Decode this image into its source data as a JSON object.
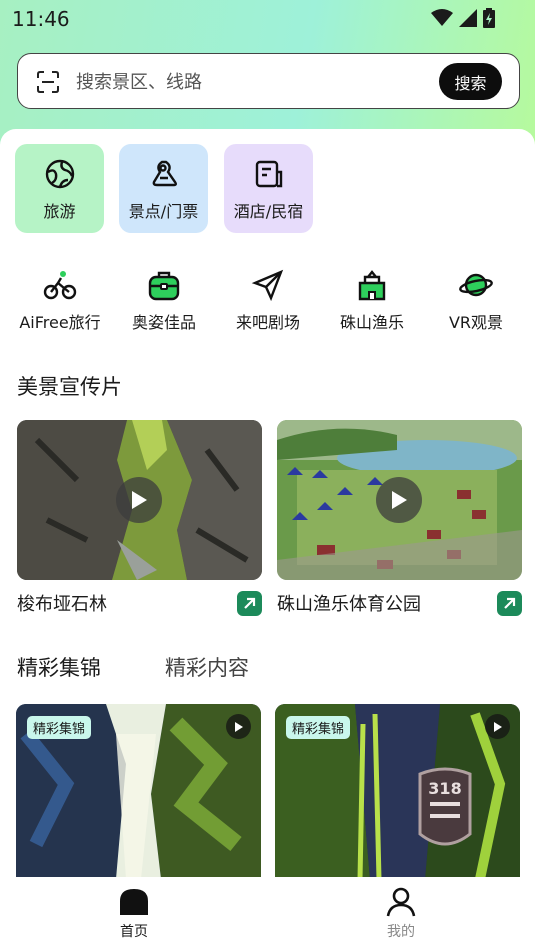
{
  "status_bar": {
    "time": "11:46"
  },
  "search": {
    "placeholder": "搜索景区、线路",
    "button": "搜索"
  },
  "categories": [
    {
      "label": "旅游",
      "icon": "globe-icon",
      "bg": "#b6f3c6"
    },
    {
      "label": "景点/门票",
      "icon": "ticket-icon",
      "bg": "#cfe6fb"
    },
    {
      "label": "酒店/民宿",
      "icon": "hotel-icon",
      "bg": "#e7dcfb"
    }
  ],
  "quick_links": [
    {
      "label": "AiFree旅行",
      "icon": "bicycle-icon"
    },
    {
      "label": "奥姿佳品",
      "icon": "bag-icon"
    },
    {
      "label": "来吧剧场",
      "icon": "paper-plane-icon"
    },
    {
      "label": "硃山渔乐",
      "icon": "castle-icon"
    },
    {
      "label": "VR观景",
      "icon": "planet-icon"
    }
  ],
  "promo": {
    "title": "美景宣传片",
    "videos": [
      {
        "title": "梭布垭石林"
      },
      {
        "title": "硃山渔乐体育公园"
      }
    ]
  },
  "tabs": [
    {
      "label": "精彩集锦",
      "active": true
    },
    {
      "label": "精彩内容",
      "active": false
    }
  ],
  "clips": [
    {
      "badge": "精彩集锦"
    },
    {
      "badge": "精彩集锦"
    }
  ],
  "bottom_nav": [
    {
      "label": "首页",
      "active": true,
      "icon": "home-icon"
    },
    {
      "label": "我的",
      "active": false,
      "icon": "user-icon"
    }
  ],
  "colors": {
    "accent": "#0d0d0d",
    "link_green": "#1c8a5a",
    "icon_green": "#2ecf5c"
  }
}
